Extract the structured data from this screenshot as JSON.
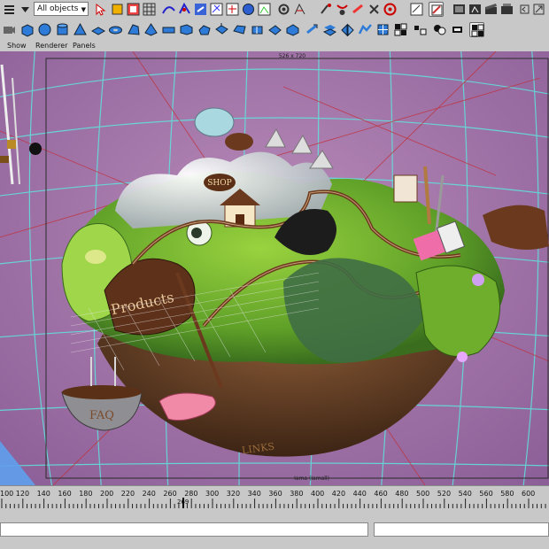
{
  "toolbar": {
    "selection_mask": "All objects",
    "row1_icons": [
      "menu-icon",
      "dropdown-arrow-icon",
      "select-by-hierarchy-icon",
      "select-by-object-icon",
      "select-by-component-icon",
      "snap-to-grid-icon",
      "snap-to-curve-icon",
      "snap-to-point-icon",
      "snap-to-view-plane-icon",
      "make-live-icon",
      "input-history-icon",
      "construction-history-icon",
      "render-frame-icon",
      "ipr-render-icon",
      "render-settings-icon",
      "graph-editor-icon",
      "hypergraph-icon",
      "outliner-icon",
      "attribute-editor-icon",
      "tool-settings-icon"
    ],
    "row2_icons": [
      "camera-icon",
      "polygon-cube-icon",
      "polygon-sphere-icon",
      "polygon-cylinder-icon",
      "polygon-cone-icon",
      "polygon-plane-icon",
      "polygon-torus-icon",
      "polygon-prism-icon",
      "polygon-pyramid-icon",
      "polygon-pipe-icon",
      "polygon-helix-icon",
      "polygon-soccer-ball-icon",
      "extrude-face-icon",
      "extrude-edge-icon",
      "split-polygon-icon",
      "merge-vertices-icon",
      "smooth-icon",
      "append-polygon-icon",
      "checker-icon",
      "uv-texture-icon",
      "mirror-icon",
      "sculpt-icon",
      "create-uv-icon",
      "separate-icon",
      "combine-icon",
      "wire-icon"
    ]
  },
  "menu": [
    "Show",
    "Renderer",
    "Panels"
  ],
  "viewport": {
    "resolution_label": "526 x 720",
    "camera_label": "Iama (Iamall)",
    "colors": {
      "background": "#a06aa8",
      "grid": "#5fe5de",
      "gate": "#2a2a2a"
    }
  },
  "ruler": {
    "ticks": [
      "100",
      "120",
      "140",
      "160",
      "180",
      "200",
      "220",
      "240",
      "260",
      "280",
      "300",
      "320",
      "340",
      "360",
      "380",
      "400",
      "420",
      "440",
      "460",
      "480",
      "500",
      "520",
      "540",
      "560",
      "580",
      "600"
    ],
    "current_frame": "269"
  }
}
